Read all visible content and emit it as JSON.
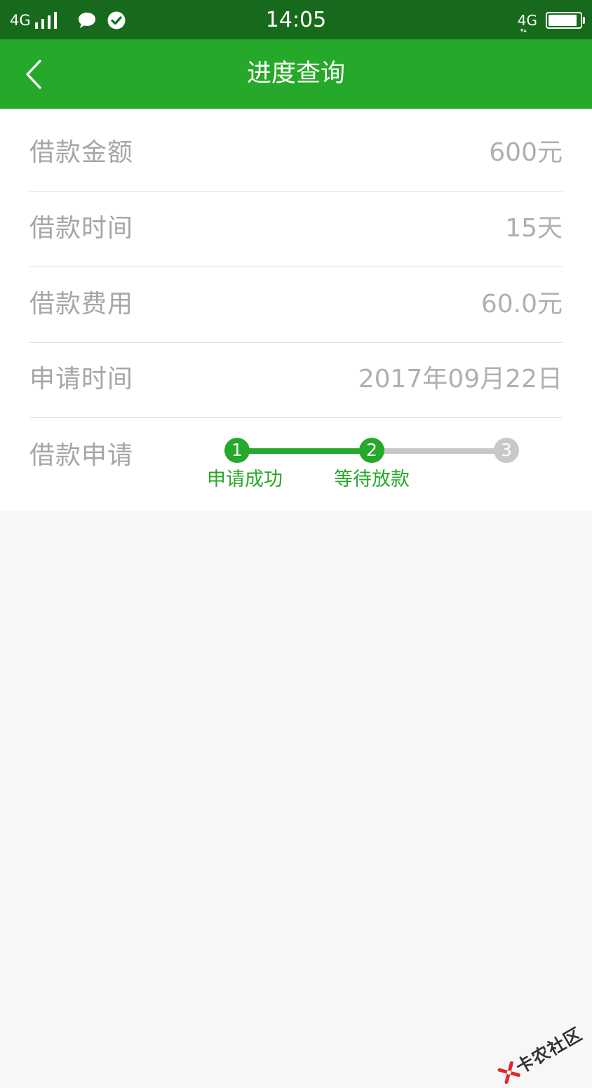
{
  "status_bar": {
    "network_left": "4G",
    "time": "14:05",
    "network_right": "4G",
    "signal_icon": "signal-bars-icon",
    "message_icon": "chat-bubble-icon",
    "check_icon": "check-circle-icon",
    "battery_icon": "battery-icon",
    "battery_level": 0.92
  },
  "header": {
    "title": "进度查询",
    "back_icon": "chevron-left-icon"
  },
  "details": [
    {
      "label": "借款金额",
      "value": "600元"
    },
    {
      "label": "借款时间",
      "value": "15天"
    },
    {
      "label": "借款费用",
      "value": "60.0元"
    },
    {
      "label": "申请时间",
      "value": "2017年09月22日"
    }
  ],
  "progress": {
    "label": "借款申请",
    "current_step": 2,
    "steps": [
      {
        "number": "1",
        "label": "申请成功",
        "status": "done"
      },
      {
        "number": "2",
        "label": "等待放款",
        "status": "current"
      },
      {
        "number": "3",
        "label": "",
        "status": "pending"
      }
    ]
  },
  "watermark": {
    "text": "卡农社区",
    "logo_icon": "kanong-logo-icon"
  },
  "colors": {
    "status_bar": "#176a1c",
    "primary": "#26a82a",
    "pending": "#c8c8c8",
    "label_text": "#a6a6a6",
    "value_text": "#b0b0b0",
    "divider": "#dedede",
    "page_bg": "#f7f7f7"
  }
}
